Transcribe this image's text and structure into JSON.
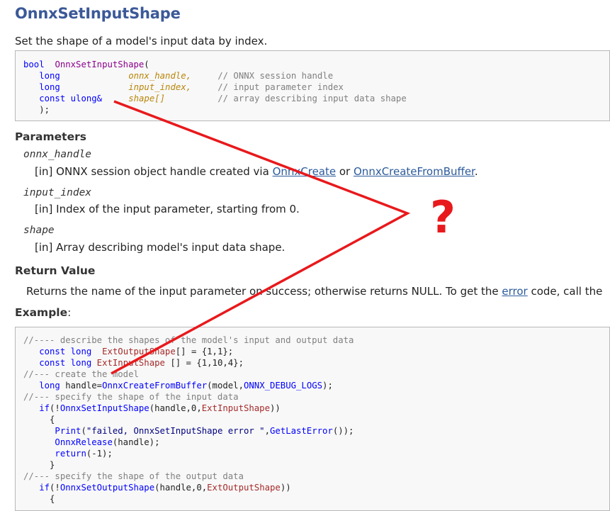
{
  "page": {
    "title": "OnnxSetInputShape",
    "summary": "Set the shape of a model's input data by index."
  },
  "prototype": {
    "ret_type": "bool",
    "func": "OnnxSetInputShape",
    "open_paren": "(",
    "close": ");",
    "params": [
      {
        "type": "long",
        "name": "onnx_handle,",
        "comment": "// ONNX session handle"
      },
      {
        "type": "long",
        "name": "input_index,",
        "comment": "// input parameter index"
      },
      {
        "type": "const ulong&",
        "name": "shape[]",
        "comment": "// array describing input data shape"
      }
    ]
  },
  "parameters": {
    "heading": "Parameters",
    "items": [
      {
        "name": "onnx_handle",
        "tag": "[in]",
        "desc_pre": "ONNX session object handle created via ",
        "link1": "OnnxCreate",
        "mid": " or ",
        "link2": "OnnxCreateFromBuffer",
        "end": "."
      },
      {
        "name": "input_index",
        "tag": "[in]",
        "desc": "Index of the input parameter, starting from 0."
      },
      {
        "name": "shape",
        "tag": "[in]",
        "desc": "Array describing model's input data shape."
      }
    ]
  },
  "return_value": {
    "heading": "Return Value",
    "text_pre": "Returns the name of the input parameter on success; otherwise returns NULL. To get the ",
    "link": "error",
    "text_post": " code, call the"
  },
  "example": {
    "heading": "Example",
    "colon": ":",
    "lines": {
      "l1": "//---- describe the shapes of the model's input and output data",
      "l2_kw": "const long",
      "l2_var": "ExtOutputShape",
      "l2_rest": "[] = {1,1};",
      "l3_kw": "const long",
      "l3_var": "ExtInputShape",
      "l3_rest": " [] = {1,10,4};",
      "l4": "//--- create the model",
      "l5_kw": "long",
      "l5_a": " handle=",
      "l5_fn": "OnnxCreateFromBuffer",
      "l5_b": "(model,",
      "l5_const": "ONNX_DEBUG_LOGS",
      "l5_c": ");",
      "l6": "//--- specify the shape of the input data",
      "l7_kw": "if",
      "l7_a": "(!",
      "l7_fn": "OnnxSetInputShape",
      "l7_b": "(handle,0,",
      "l7_var": "ExtInputShape",
      "l7_c": "))",
      "l8": "{",
      "l9_fn": "Print",
      "l9_a": "(",
      "l9_str": "\"failed, OnnxSetInputShape error \"",
      "l9_b": ",",
      "l9_fn2": "GetLastError",
      "l9_c": "());",
      "l10_fn": "OnnxRelease",
      "l10_a": "(handle);",
      "l11_kw": "return",
      "l11_a": "(-1);",
      "l12": "}",
      "l13": "//--- specify the shape of the output data",
      "l14_kw": "if",
      "l14_a": "(!",
      "l14_fn": "OnnxSetOutputShape",
      "l14_b": "(handle,0,",
      "l14_var": "ExtOutputShape",
      "l14_c": "))",
      "l15": "{"
    }
  },
  "annotation": {
    "mark": "?",
    "color": "#e8191c"
  }
}
